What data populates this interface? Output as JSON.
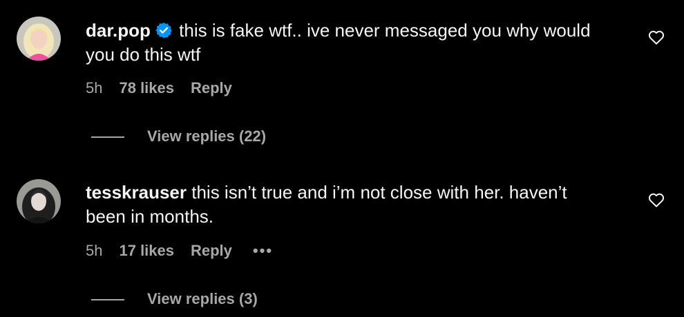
{
  "colors": {
    "background": "#000000",
    "primary_text": "#f5f5f5",
    "secondary_text": "#a8a8a8",
    "verified_badge": "#0095f6"
  },
  "comments": [
    {
      "username": "dar.pop",
      "verified": true,
      "text": "this is fake wtf.. ive never messaged you why would you do this wtf",
      "time": "5h",
      "likes": "78 likes",
      "reply_label": "Reply",
      "view_replies": "View replies (22)",
      "icons": {
        "like": "heart-outline-icon",
        "verified": "verified-badge-icon"
      }
    },
    {
      "username": "tesskrauser",
      "verified": false,
      "text": "this isn’t true and i’m not close with her. haven’t been in months.",
      "time": "5h",
      "likes": "17 likes",
      "reply_label": "Reply",
      "more_label": "•••",
      "view_replies": "View replies (3)",
      "icons": {
        "like": "heart-outline-icon",
        "more": "more-options-icon"
      }
    }
  ]
}
